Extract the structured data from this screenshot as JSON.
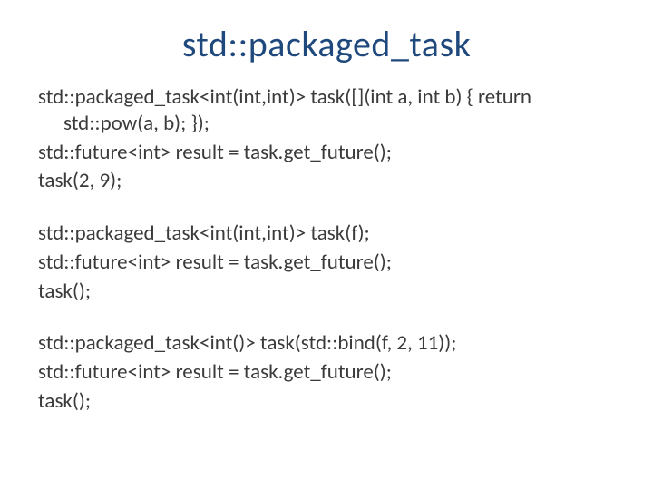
{
  "title": "std::packaged_task",
  "lines": {
    "l1": "std::packaged_task<int(int,int)> task([](int a, int b) { return std::pow(a, b); });",
    "l2": "std::future<int> result = task.get_future();",
    "l3": "task(2, 9);",
    "l4": "std::packaged_task<int(int,int)> task(f);",
    "l5": "std::future<int> result = task.get_future();",
    "l6": "task();",
    "l7": "std::packaged_task<int()> task(std::bind(f, 2, 11));",
    "l8": "std::future<int> result = task.get_future();",
    "l9": "task();"
  }
}
